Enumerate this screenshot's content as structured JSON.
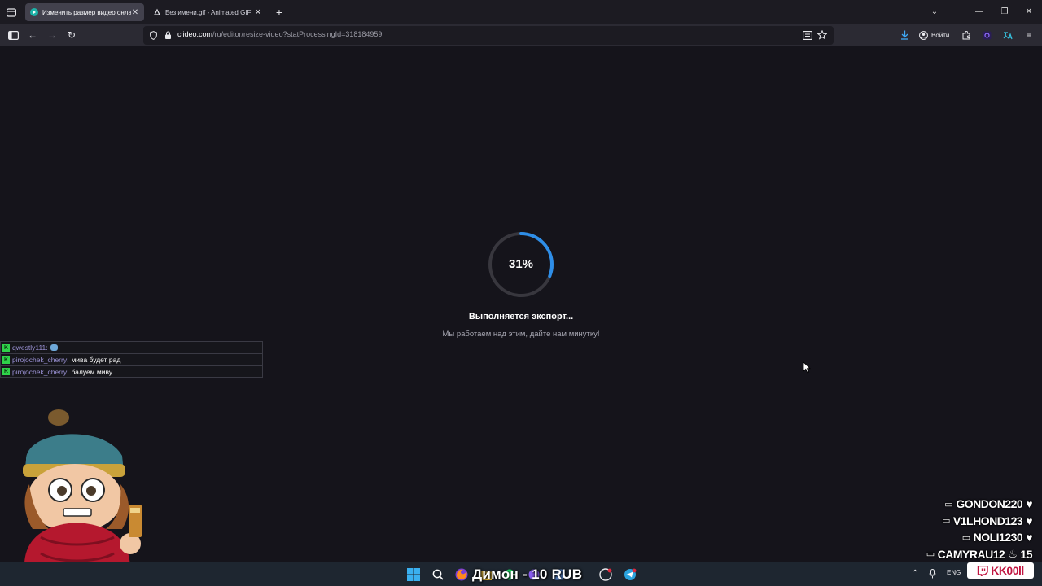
{
  "browser": {
    "tabs": [
      {
        "title": "Изменить размер видео онлайн",
        "active": true
      },
      {
        "title": "Без имени.gif - Animated GIF",
        "active": false
      }
    ],
    "new_tab_symbol": "+",
    "url_host": "clideo.com",
    "url_path": "/ru/editor/resize-video?statProcessingId=318184959",
    "signin_label": "Войти"
  },
  "page": {
    "progress_percent": 31,
    "progress_label": "31%",
    "status_title": "Выполняется экспорт...",
    "status_subtitle": "Мы работаем над этим, дайте нам минутку!",
    "accent_color": "#2e8ee8"
  },
  "chat": [
    {
      "user": "qwestly111:",
      "message": "",
      "has_emote": true
    },
    {
      "user": "pirojochek_cherry:",
      "message": "мива будет рад",
      "has_emote": false
    },
    {
      "user": "pirojochek_cherry:",
      "message": "балуем миву",
      "has_emote": false
    }
  ],
  "subscribers": [
    {
      "name": "GONDON220",
      "suffix": "",
      "icon": "twitch-icon"
    },
    {
      "name": "V1LHOND123",
      "suffix": "",
      "icon": "twitch-icon"
    },
    {
      "name": "NOLI1230",
      "suffix": "",
      "icon": "twitch-icon"
    },
    {
      "name": "CAMYRAU12",
      "suffix": "15",
      "icon": "twitch-icon"
    }
  ],
  "taskbar": {
    "donation_text": "Димон - 10 RUB",
    "language": "ENG",
    "stream_badge": "KK00ll"
  }
}
